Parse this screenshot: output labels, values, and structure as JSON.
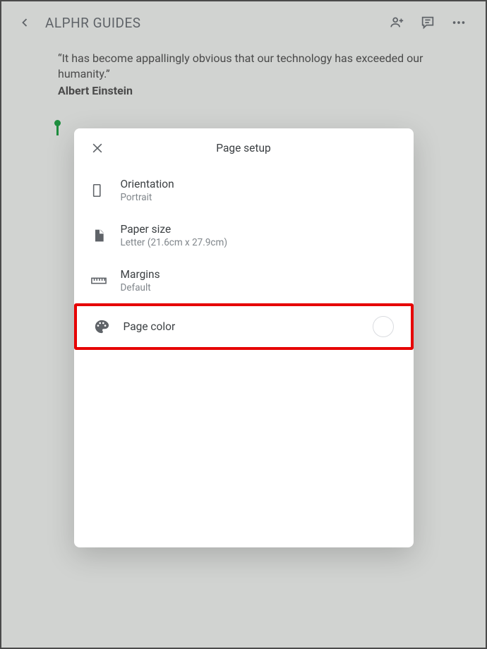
{
  "header": {
    "title": "ALPHR GUIDES"
  },
  "document": {
    "quote": "“It has become appallingly obvious that our technology has exceeded our humanity.”",
    "author": "Albert Einstein"
  },
  "modal": {
    "title": "Page setup",
    "items": {
      "orientation": {
        "label": "Orientation",
        "value": "Portrait"
      },
      "paperSize": {
        "label": "Paper size",
        "value": "Letter (21.6cm x 27.9cm)"
      },
      "margins": {
        "label": "Margins",
        "value": "Default"
      },
      "pageColor": {
        "label": "Page color"
      }
    }
  }
}
